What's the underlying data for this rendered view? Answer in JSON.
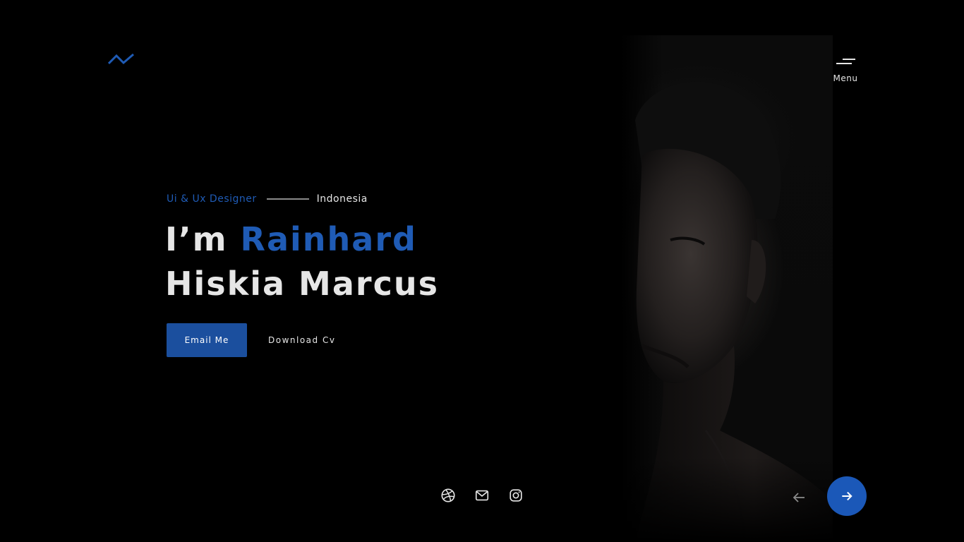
{
  "brand": {
    "logo_icon": "zigzag-logo-icon",
    "logo_color": "#1f5bb5"
  },
  "header": {
    "menu_label": "Menu",
    "menu_icon": "hamburger-menu-icon"
  },
  "hero": {
    "role": "Ui & Ux Designer",
    "country": "Indonesia",
    "greeting": "I’m ",
    "first_name": "Rainhard",
    "last_name": "Hiskia Marcus",
    "email_button": "Email Me",
    "download_link": "Download Cv"
  },
  "socials": [
    {
      "name": "dribbble",
      "icon": "dribbble-icon"
    },
    {
      "name": "email",
      "icon": "mail-icon"
    },
    {
      "name": "instagram",
      "icon": "instagram-icon"
    }
  ],
  "carousel": {
    "prev_icon": "arrow-left-icon",
    "next_icon": "arrow-right-icon"
  },
  "colors": {
    "background": "#000000",
    "accent": "#1f5bb5",
    "button": "#1b4f9e",
    "text": "#e6e6e6"
  }
}
